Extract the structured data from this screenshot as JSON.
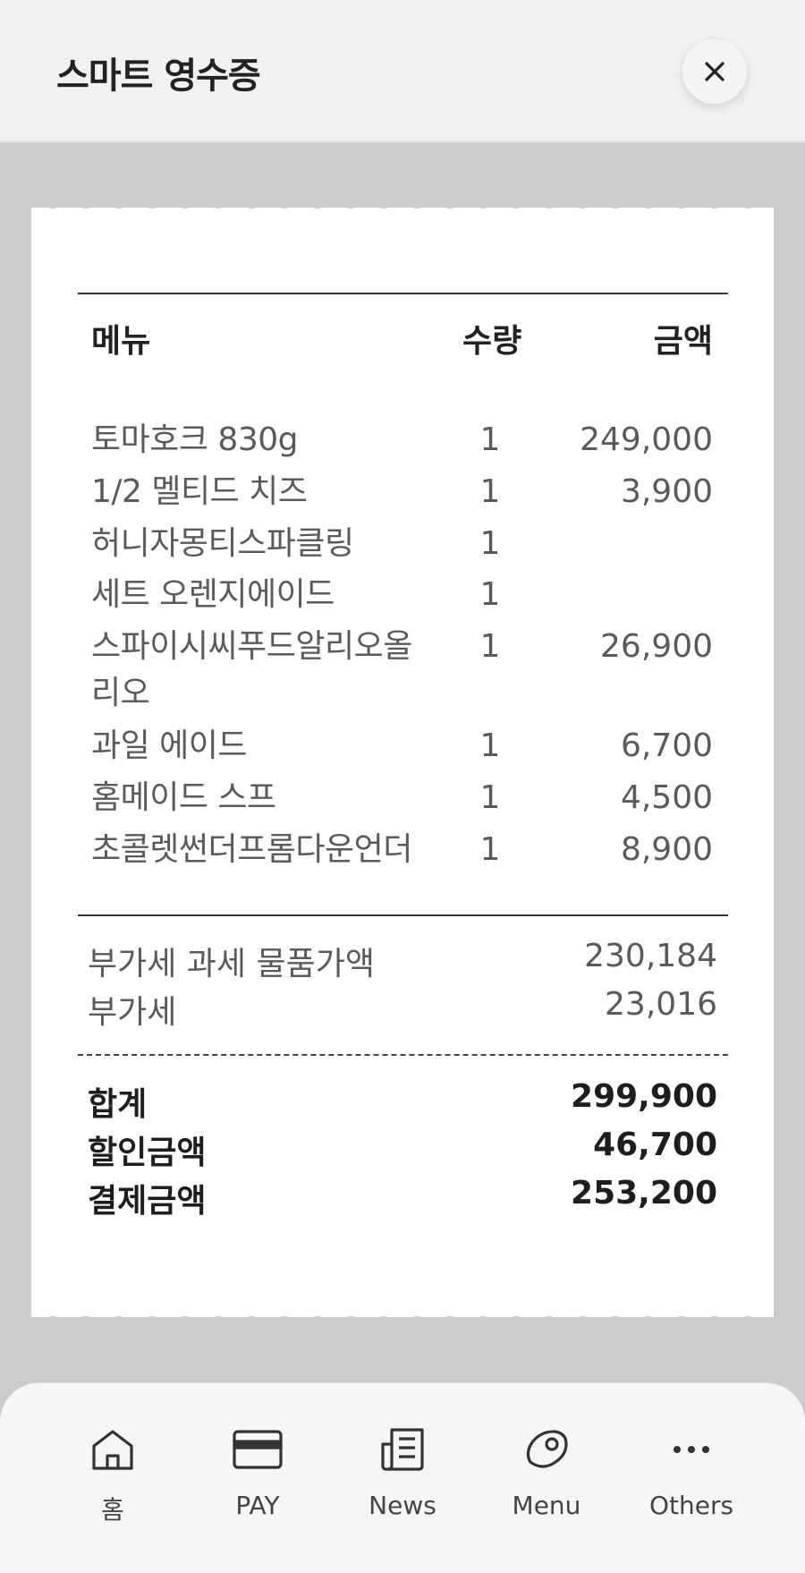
{
  "header": {
    "title": "스마트 영수증"
  },
  "receipt": {
    "columns": {
      "menu": "메뉴",
      "qty": "수량",
      "amount": "금액"
    },
    "items": [
      {
        "name": "토마호크 830g",
        "qty": "1",
        "amount": "249,000"
      },
      {
        "name": "1/2 멜티드 치즈",
        "qty": "1",
        "amount": "3,900"
      },
      {
        "name": "허니자몽티스파클링",
        "qty": "1",
        "amount": ""
      },
      {
        "name": "세트 오렌지에이드",
        "qty": "1",
        "amount": ""
      },
      {
        "name": "스파이시씨푸드알리오올",
        "name_line2": "리오",
        "qty": "1",
        "amount": "26,900"
      },
      {
        "name": "과일 에이드",
        "qty": "1",
        "amount": "6,700"
      },
      {
        "name": "홈메이드 스프",
        "qty": "1",
        "amount": "4,500"
      },
      {
        "name": "초콜렛썬더프롬다운언더",
        "qty": "1",
        "amount": "8,900"
      }
    ],
    "tax": {
      "taxable_label": "부가세 과세 물품가액",
      "taxable_value": "230,184",
      "vat_label": "부가세",
      "vat_value": "23,016"
    },
    "totals": {
      "total_label": "합계",
      "total_value": "299,900",
      "discount_label": "할인금액",
      "discount_value": "46,700",
      "payment_label": "결제금액",
      "payment_value": "253,200"
    }
  },
  "nav": {
    "items": [
      {
        "label": "홈",
        "icon": "home-icon"
      },
      {
        "label": "PAY",
        "icon": "card-icon"
      },
      {
        "label": "News",
        "icon": "news-icon"
      },
      {
        "label": "Menu",
        "icon": "steak-icon"
      },
      {
        "label": "Others",
        "icon": "more-icon"
      }
    ]
  },
  "colors": {
    "backdrop": "#cbcbcb",
    "header_bg": "#f1f1f1",
    "receipt_bg": "#ffffff",
    "text_dark": "#1e1e1e",
    "text_muted": "#5a5a5a"
  }
}
